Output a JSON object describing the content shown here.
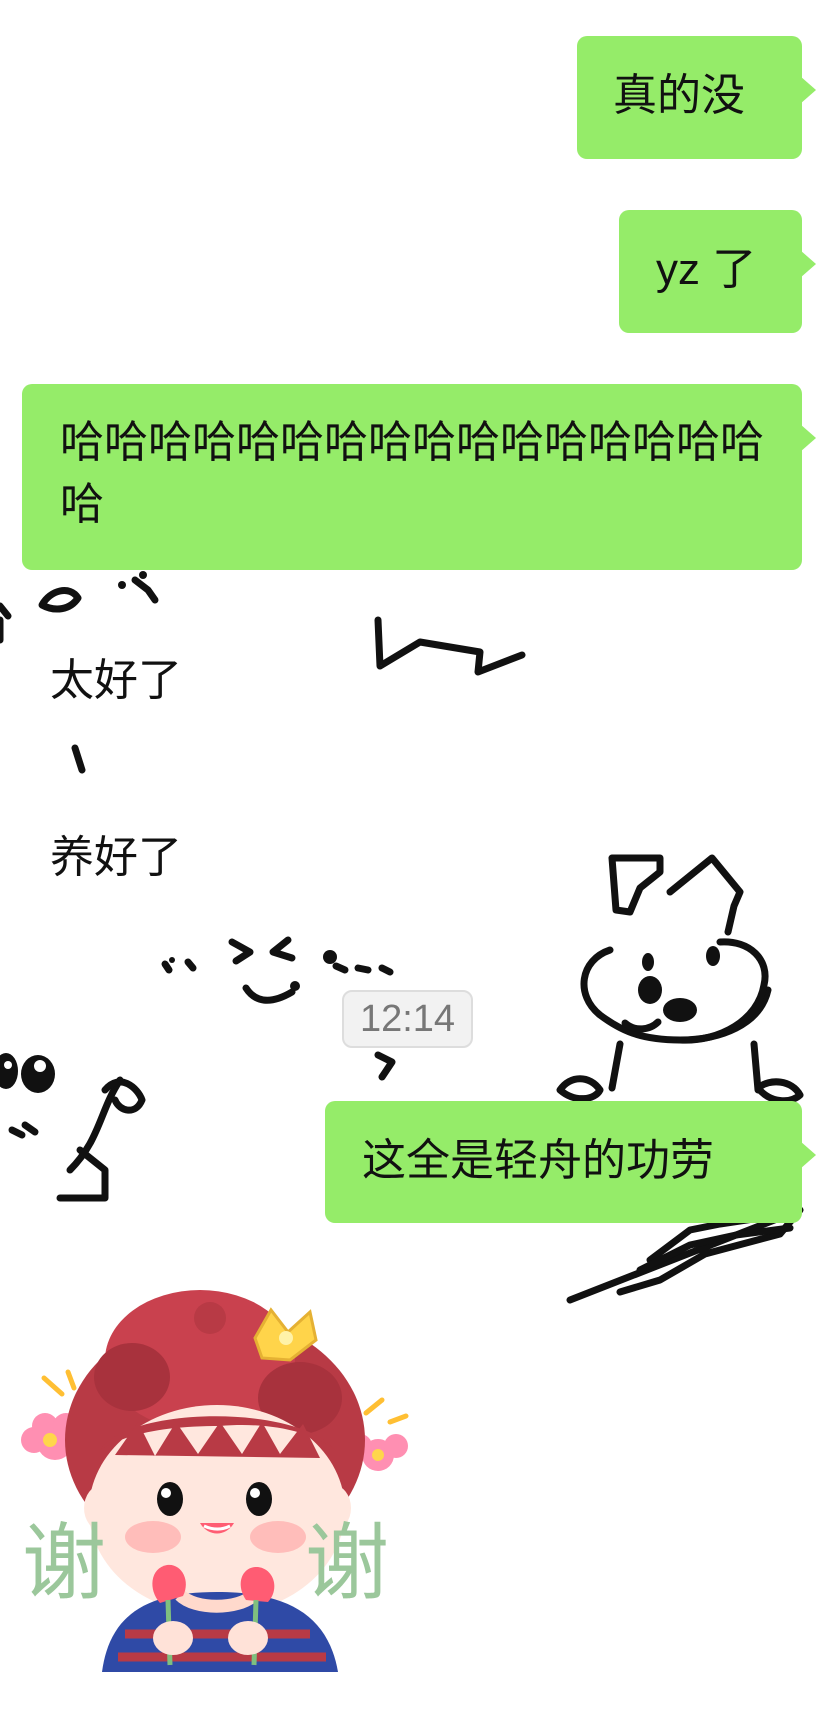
{
  "messages": {
    "outgoing_1": "真的没",
    "outgoing_2": "yz 了",
    "outgoing_3": "哈哈哈哈哈哈哈哈哈哈哈哈哈哈哈哈哈",
    "incoming_1": "太好了",
    "incoming_2": "养好了",
    "time": "12:14",
    "outgoing_4": "这全是轻舟的功劳"
  },
  "sticker": {
    "char_left": "谢",
    "char_right": "谢"
  },
  "colors": {
    "outgoing_bubble": "#95ec69",
    "background": "#ffffff",
    "timestamp_text": "#777777",
    "sticker_hair": "#b83a45",
    "sticker_text": "#9bc79b"
  }
}
